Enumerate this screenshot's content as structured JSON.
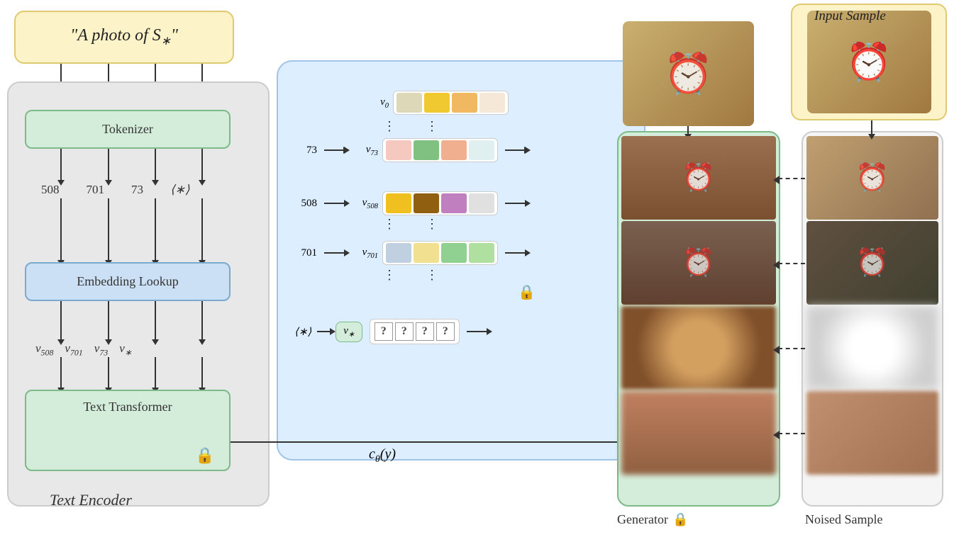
{
  "phrase": {
    "text": "\"A photo of S*\""
  },
  "tokenizer": {
    "label": "Tokenizer"
  },
  "tokens": {
    "t1": "508",
    "t2": "701",
    "t3": "73",
    "t4": "⟨∗⟩"
  },
  "embedding": {
    "label": "Embedding Lookup"
  },
  "vectors": {
    "v1": "v508",
    "v2": "v701",
    "v3": "v73",
    "v4": "v*"
  },
  "text_transformer": {
    "label": "Text Transformer"
  },
  "text_encoder_label": "Text Encoder",
  "vocab_entries": [
    {
      "index": "v0",
      "colors": [
        "#e0d0a0",
        "#f0c840",
        "#f0b870",
        "#f0e0d0"
      ]
    },
    {
      "index": "v73",
      "colors": [
        "#f0c8c0",
        "#80c080",
        "#f0b090",
        "#e0f0f0"
      ]
    },
    {
      "index": "v508",
      "colors": [
        "#f0c020",
        "#a06010",
        "#c080c0",
        "#e0e0e0"
      ]
    },
    {
      "index": "v701",
      "colors": [
        "#c0d0e0",
        "#f0e0a0",
        "#a0d0a0",
        "#c0e0b0"
      ]
    }
  ],
  "vstar_label": "v*",
  "question_marks": [
    "?",
    "?",
    "?",
    "?"
  ],
  "lstar_label": "⟨∗⟩",
  "vocab_indices": {
    "i73": "73",
    "i508": "508",
    "i701": "701"
  },
  "c_theta_label": "c_θ(y)",
  "generator_label": "Generator",
  "noised_label": "Noised Sample",
  "input_label": "Input Sample",
  "lock_emoji": "🔒",
  "arrows": {
    "down": "↓",
    "right": "→",
    "left": "←"
  }
}
